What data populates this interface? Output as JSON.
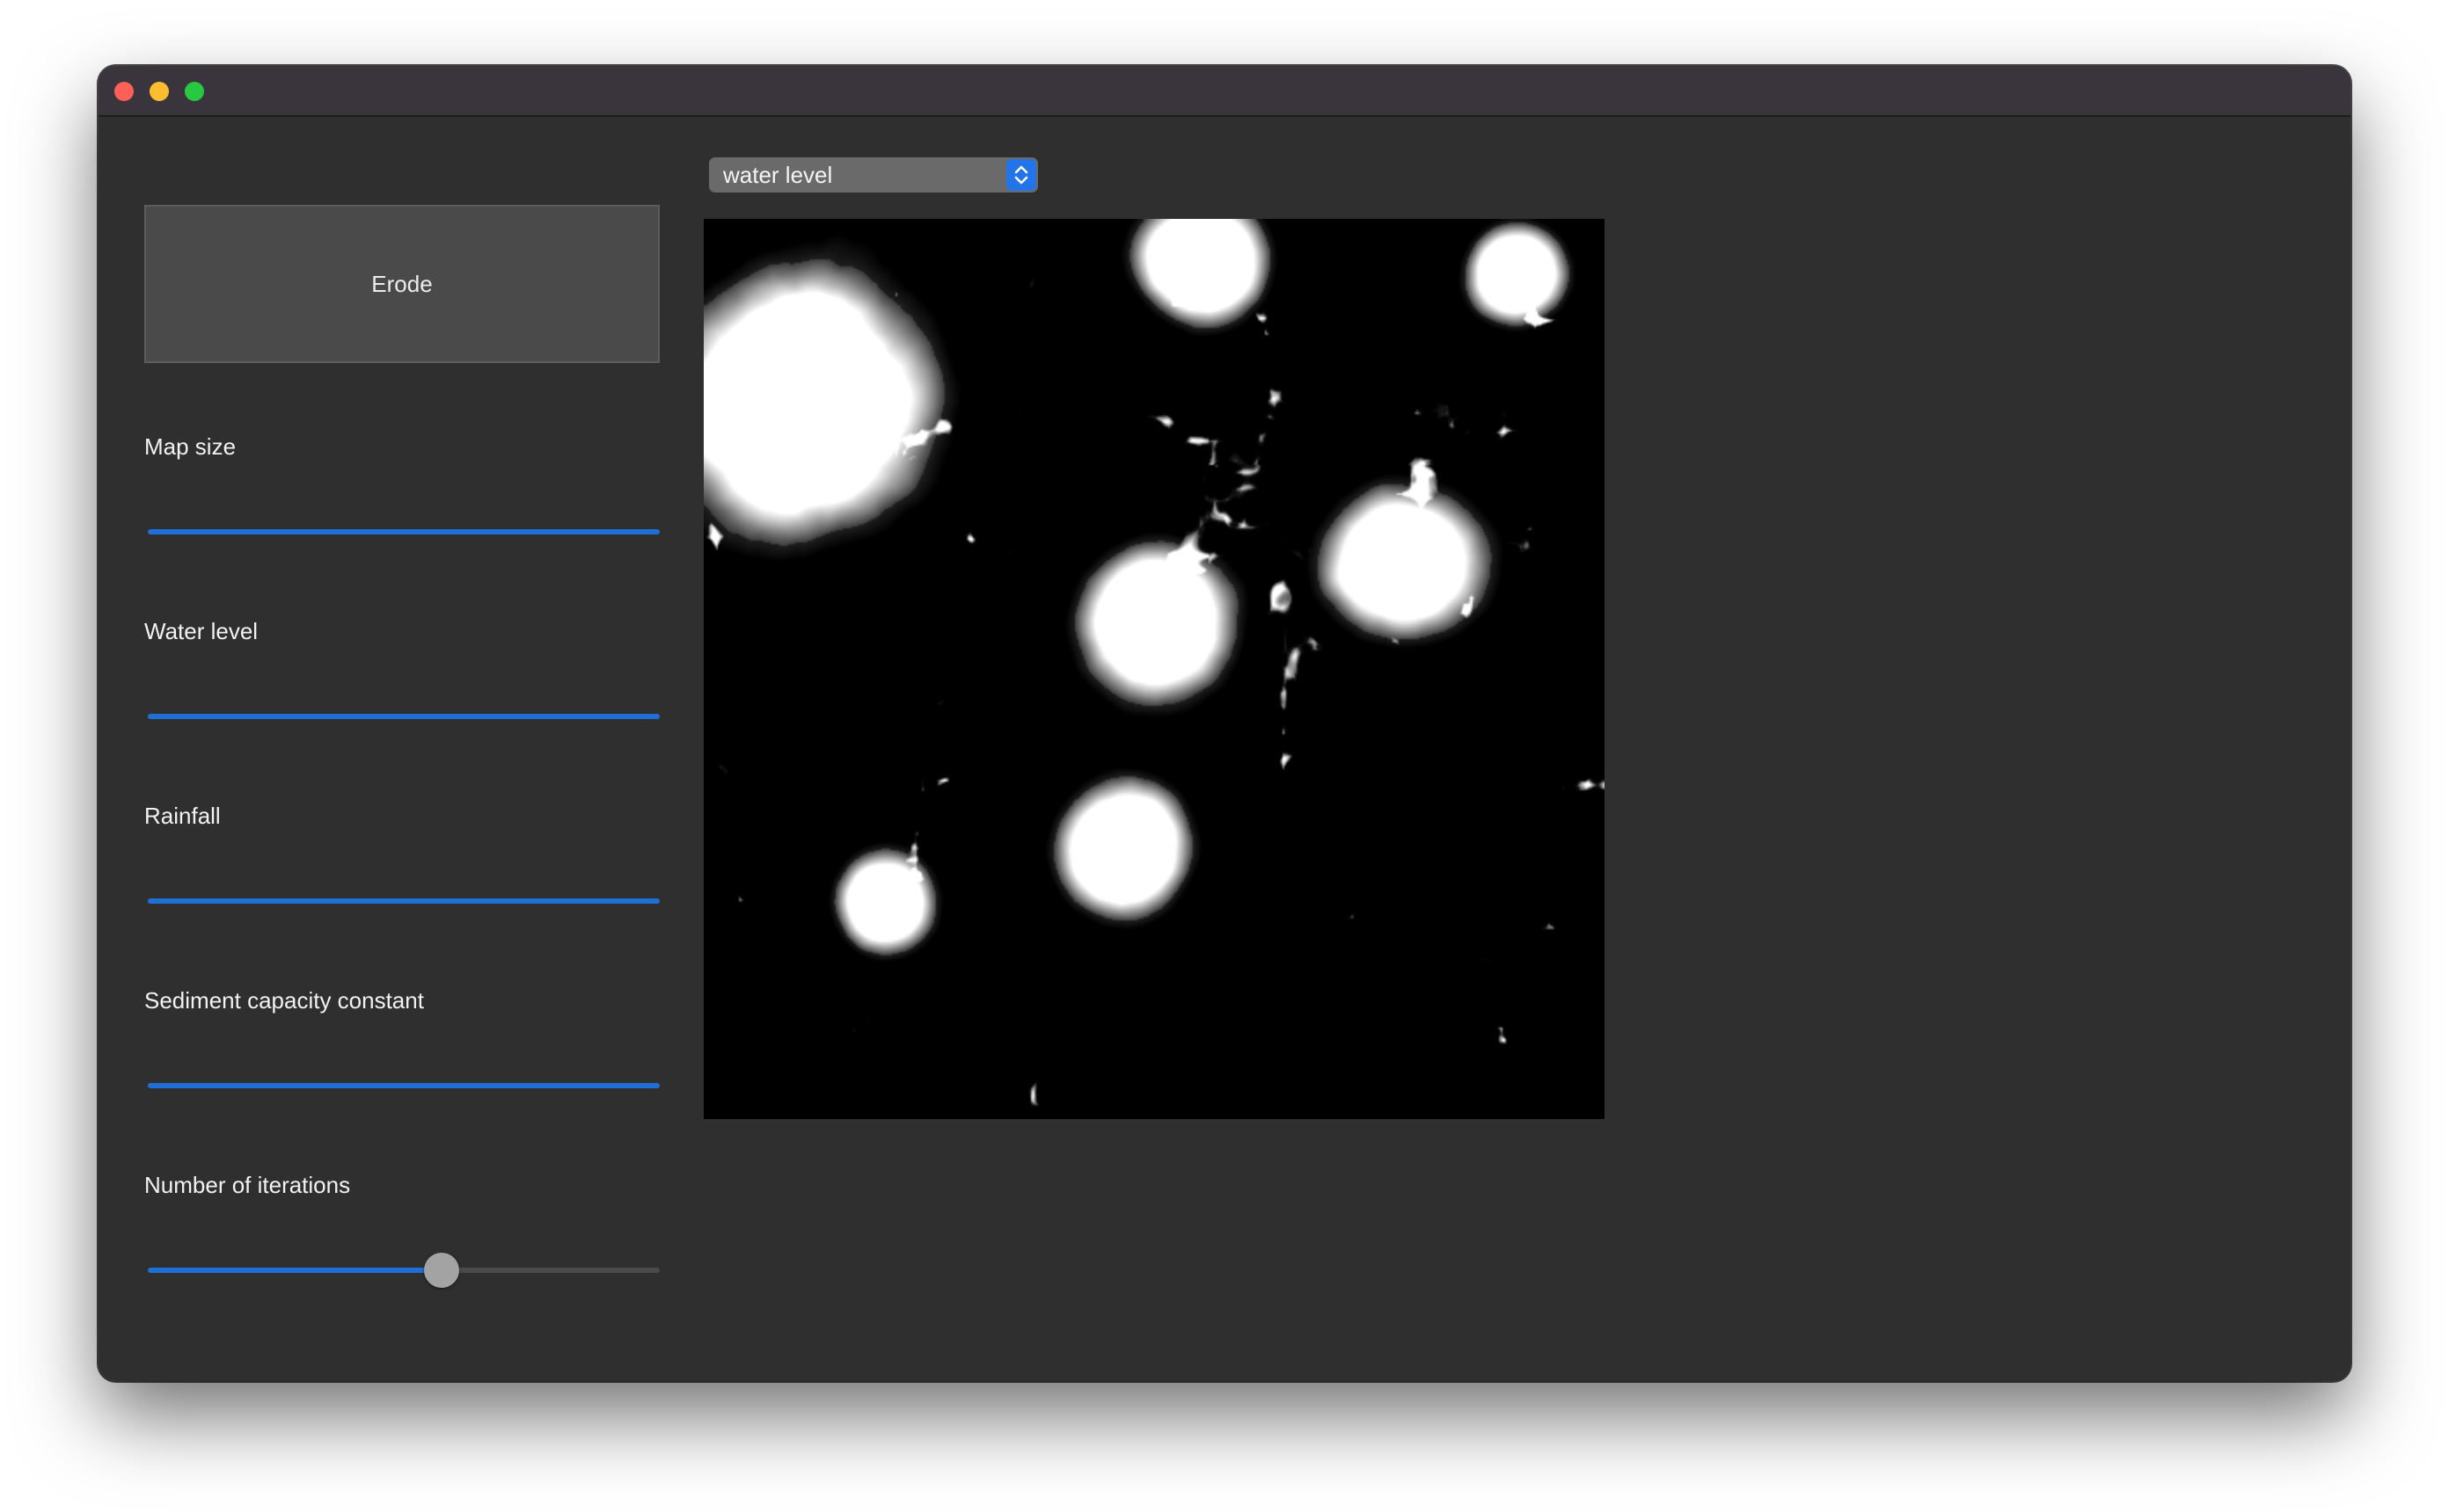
{
  "window": {
    "traffic_lights": [
      "close",
      "minimize",
      "maximize"
    ]
  },
  "sidebar": {
    "erode_label": "Erode",
    "sliders": [
      {
        "label": "Map size",
        "value_fraction": 1.0
      },
      {
        "label": "Water level",
        "value_fraction": 1.0
      },
      {
        "label": "Rainfall",
        "value_fraction": 1.0
      },
      {
        "label": "Sediment capacity constant",
        "value_fraction": 1.0
      },
      {
        "label": "Number of iterations",
        "value_fraction": 0.58
      }
    ]
  },
  "view": {
    "selected": "water level"
  },
  "colors": {
    "window_bg": "#2f2f2f",
    "titlebar_bg": "#3a353c",
    "accent": "#1f6fd6",
    "button_bg": "#4a4a4a"
  }
}
